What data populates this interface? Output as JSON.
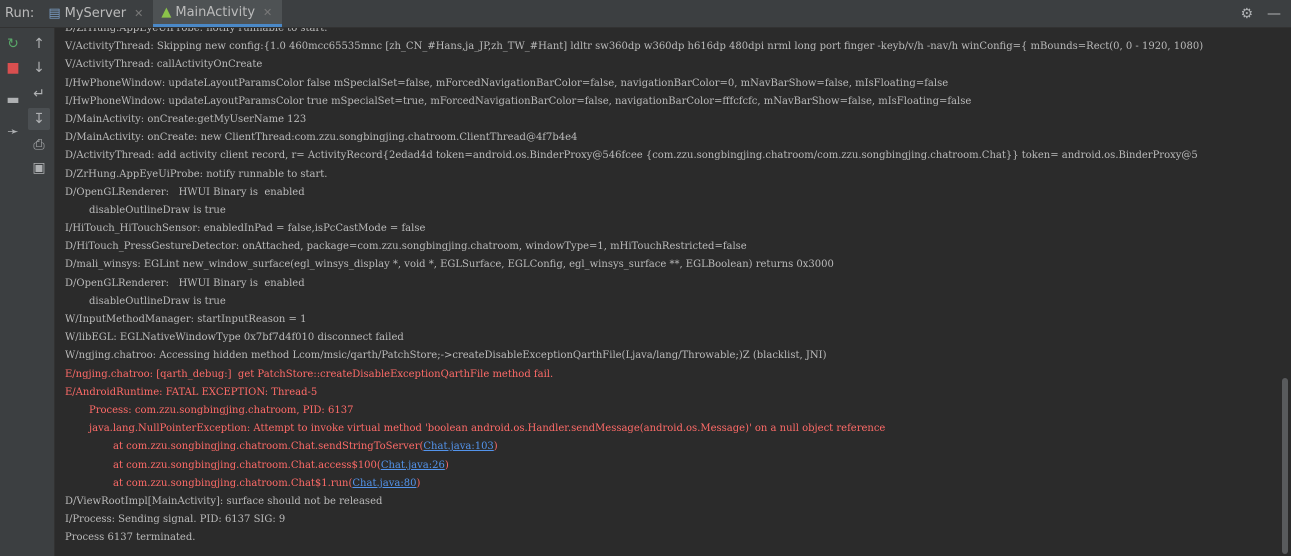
{
  "topbar": {
    "run_label": "Run:",
    "tabs": [
      {
        "label": "MyServer",
        "icon": "run-config-icon"
      },
      {
        "label": "MainActivity",
        "icon": "android-icon"
      }
    ],
    "right_icons": [
      "gear-icon",
      "minimize-icon"
    ]
  },
  "toolbar": {
    "icons": [
      "rerun-icon",
      "stop-icon",
      "layout-icon",
      "pin-icon",
      "up-arrow-icon",
      "down-arrow-icon",
      "soft-wrap-icon",
      "scroll-to-end-icon",
      "print-icon",
      "trash-icon"
    ]
  },
  "colors": {
    "error": "#ff6b68",
    "link": "#5394ec",
    "normal": "#bbbbbb"
  },
  "console": {
    "lines": [
      {
        "text": "D/ZrHung.AppEyeUiProbe: notify runnable to start.",
        "level": "normal"
      },
      {
        "text": "V/ActivityThread: Skipping new config:{1.0 460mcc65535mnc [zh_CN_#Hans,ja_JP,zh_TW_#Hant] ldltr sw360dp w360dp h616dp 480dpi nrml long port finger -keyb/v/h -nav/h winConfig={ mBounds=Rect(0, 0 - 1920, 1080)",
        "level": "normal"
      },
      {
        "text": "V/ActivityThread: callActivityOnCreate",
        "level": "normal"
      },
      {
        "text": "I/HwPhoneWindow: updateLayoutParamsColor false mSpecialSet=false, mForcedNavigationBarColor=false, navigationBarColor=0, mNavBarShow=false, mIsFloating=false",
        "level": "normal"
      },
      {
        "text": "I/HwPhoneWindow: updateLayoutParamsColor true mSpecialSet=true, mForcedNavigationBarColor=false, navigationBarColor=fffcfcfc, mNavBarShow=false, mIsFloating=false",
        "level": "normal"
      },
      {
        "text": "D/MainActivity: onCreate:getMyUserName 123",
        "level": "normal"
      },
      {
        "text": "D/MainActivity: onCreate: new ClientThread:com.zzu.songbingjing.chatroom.ClientThread@4f7b4e4",
        "level": "normal"
      },
      {
        "text": "D/ActivityThread: add activity client record, r= ActivityRecord{2edad4d token=android.os.BinderProxy@546fcee {com.zzu.songbingjing.chatroom/com.zzu.songbingjing.chatroom.Chat}} token= android.os.BinderProxy@5",
        "level": "normal"
      },
      {
        "text": "D/ZrHung.AppEyeUiProbe: notify runnable to start.",
        "level": "normal"
      },
      {
        "text": "D/OpenGLRenderer:   HWUI Binary is  enabled",
        "level": "normal"
      },
      {
        "text": "disableOutlineDraw is true",
        "level": "normal",
        "indent": 1
      },
      {
        "text": "I/HiTouch_HiTouchSensor: enabledInPad = false,isPcCastMode = false",
        "level": "normal"
      },
      {
        "text": "D/HiTouch_PressGestureDetector: onAttached, package=com.zzu.songbingjing.chatroom, windowType=1, mHiTouchRestricted=false",
        "level": "normal"
      },
      {
        "text": "D/mali_winsys: EGLint new_window_surface(egl_winsys_display *, void *, EGLSurface, EGLConfig, egl_winsys_surface **, EGLBoolean) returns 0x3000",
        "level": "normal"
      },
      {
        "text": "D/OpenGLRenderer:   HWUI Binary is  enabled",
        "level": "normal"
      },
      {
        "text": "disableOutlineDraw is true",
        "level": "normal",
        "indent": 1
      },
      {
        "text": "W/InputMethodManager: startInputReason = 1",
        "level": "normal"
      },
      {
        "text": "W/libEGL: EGLNativeWindowType 0x7bf7d4f010 disconnect failed",
        "level": "normal"
      },
      {
        "text": "W/ngjing.chatroo: Accessing hidden method Lcom/msic/qarth/PatchStore;->createDisableExceptionQarthFile(Ljava/lang/Throwable;)Z (blacklist, JNI)",
        "level": "normal"
      },
      {
        "text": "E/ngjing.chatroo: [qarth_debug:]  get PatchStore::createDisableExceptionQarthFile method fail.",
        "level": "error"
      },
      {
        "text": "E/AndroidRuntime: FATAL EXCEPTION: Thread-5",
        "level": "error"
      },
      {
        "text": "Process: com.zzu.songbingjing.chatroom, PID: 6137",
        "level": "error",
        "indent": 2
      },
      {
        "text": "java.lang.NullPointerException: Attempt to invoke virtual method 'boolean android.os.Handler.sendMessage(android.os.Message)' on a null object reference",
        "level": "error",
        "indent": 2
      },
      {
        "text": "at com.zzu.songbingjing.chatroom.Chat.sendStringToServer(",
        "link": "Chat.java:103",
        "after": ")",
        "level": "error",
        "indent": 3
      },
      {
        "text": "at com.zzu.songbingjing.chatroom.Chat.access$100(",
        "link": "Chat.java:26",
        "after": ")",
        "level": "error",
        "indent": 3
      },
      {
        "text": "at com.zzu.songbingjing.chatroom.Chat$1.run(",
        "link": "Chat.java:80",
        "after": ")",
        "level": "error",
        "indent": 3
      },
      {
        "text": "D/ViewRootImpl[MainActivity]: surface should not be released",
        "level": "normal"
      },
      {
        "text": "I/Process: Sending signal. PID: 6137 SIG: 9",
        "level": "normal"
      },
      {
        "text": "Process 6137 terminated.",
        "level": "normal"
      }
    ]
  }
}
